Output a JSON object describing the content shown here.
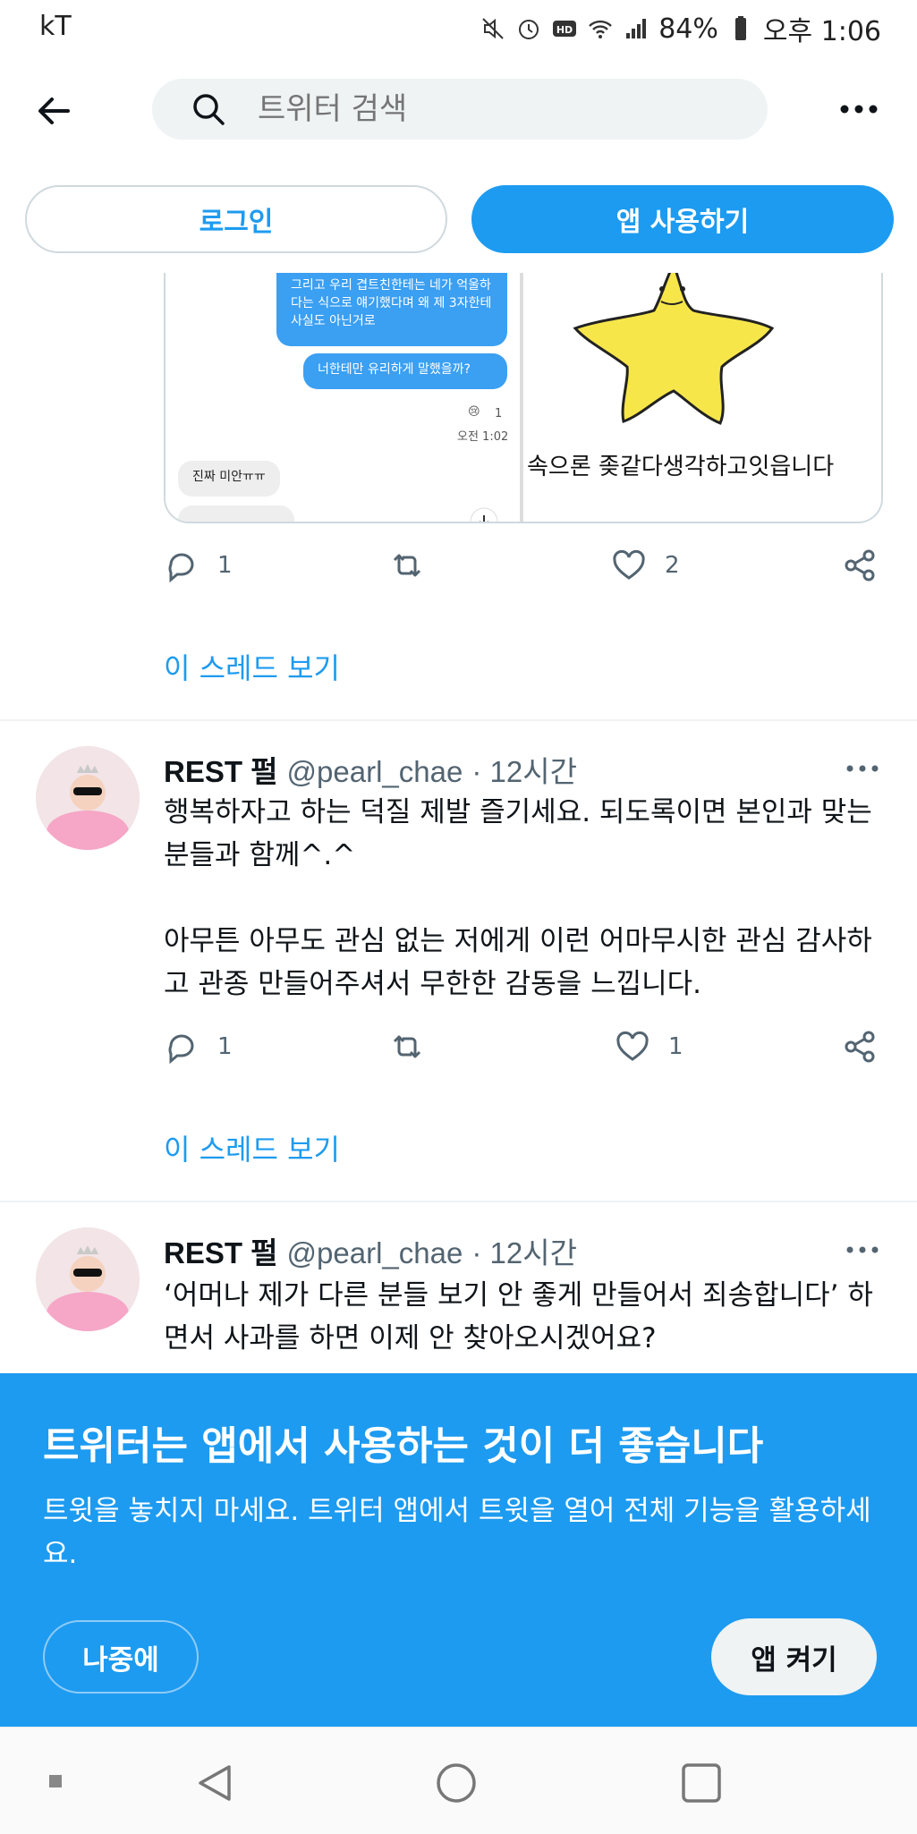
{
  "status_bar": {
    "carrier": "kT",
    "battery": "84%",
    "time": "오후 1:06"
  },
  "header": {
    "search_placeholder": "트위터 검색"
  },
  "auth": {
    "login_label": "로그인",
    "use_app_label": "앱 사용하기"
  },
  "media_card": {
    "chat": {
      "message_1": "그리고 우리 겹트친한테는 네가 억울하다는 식으로 얘기했다며 왜 제 3자한테 사실도 아닌거로",
      "message_2": "너한테만 유리하게 말했을까?",
      "reaction_count": "1",
      "time": "오전 1:02",
      "reply": "진짜 미안ㅠㅠ"
    },
    "star_caption": "속으론 좆같다생각하고잇읍니다"
  },
  "tweet_0": {
    "reply_count": "1",
    "like_count": "2",
    "thread_link": "이 스레드 보기"
  },
  "tweet_1": {
    "name": "REST 펄",
    "handle": "@pearl_chae",
    "time": "· 12시간",
    "text": "행복하자고 하는 덕질 제발 즐기세요. 되도록이면 본인과 맞는 분들과 함께^.^\n\n아무튼 아무도 관심 없는 저에게 이런 어마무시한 관심 감사하고 관종 만들어주셔서 무한한 감동을 느낍니다.",
    "reply_count": "1",
    "like_count": "1",
    "thread_link": "이 스레드 보기"
  },
  "tweet_2": {
    "name": "REST 펄",
    "handle": "@pearl_chae",
    "time": "· 12시간",
    "text": "‘어머나 제가 다른 분들 보기 안 좋게 만들어서 죄송합니다’ 하면서 사과를 하면 이제 안 찾아오시겠어요?"
  },
  "banner": {
    "title": "트위터는 앱에서 사용하는 것이 더 좋습니다",
    "description": "트윗을 놓치지 마세요. 트위터 앱에서 트윗을 열어 전체 기능을 활용하세요.",
    "later_label": "나중에",
    "open_label": "앱 켜기"
  },
  "colors": {
    "accent": "#1d9bf0",
    "text_primary": "#0f1419",
    "text_secondary": "#536471",
    "search_bg": "#eff3f4"
  },
  "icons": [
    "back-arrow-icon",
    "search-icon",
    "more-icon",
    "reply-icon",
    "retweet-icon",
    "like-icon",
    "share-icon",
    "mute-icon",
    "alarm-icon",
    "hd-icon",
    "wifi-icon",
    "signal-icon",
    "battery-icon",
    "nav-menu-icon",
    "nav-back-icon",
    "nav-home-icon",
    "nav-recents-icon"
  ]
}
